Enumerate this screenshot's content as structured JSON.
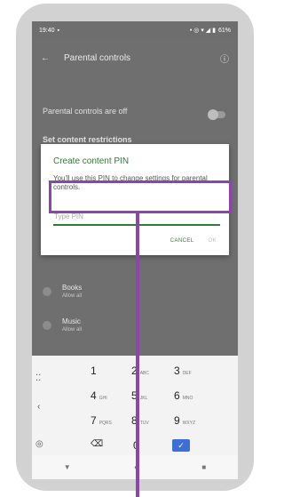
{
  "status_bar": {
    "time": "19:40",
    "left_icon": "notification-icon",
    "right_icons": "• ◎ ▾ ◢ ▮",
    "battery": "61%"
  },
  "app_bar": {
    "back_icon": "←",
    "title": "Parental controls",
    "info_icon": "ⓘ"
  },
  "settings": {
    "status_text": "Parental controls are off",
    "section_title": "Set content restrictions",
    "items": [
      {
        "title": "Books",
        "subtitle": "Allow all"
      },
      {
        "title": "Music",
        "subtitle": "Allow all"
      }
    ]
  },
  "dialog": {
    "title": "Create content PIN",
    "body": "You'll use this PIN to change settings for parental controls.",
    "pin_placeholder": "Type PIN",
    "cancel_label": "CANCEL",
    "ok_label": "OK"
  },
  "keyboard": {
    "rows": [
      [
        {
          "digit": "1",
          "sub": ""
        },
        {
          "digit": "2",
          "sub": "ABC"
        },
        {
          "digit": "3",
          "sub": "DEF"
        }
      ],
      [
        {
          "digit": "4",
          "sub": "GHI"
        },
        {
          "digit": "5",
          "sub": "JKL"
        },
        {
          "digit": "6",
          "sub": "MNO"
        }
      ],
      [
        {
          "digit": "7",
          "sub": "PQRS"
        },
        {
          "digit": "8",
          "sub": "TUV"
        },
        {
          "digit": "9",
          "sub": "WXYZ"
        }
      ]
    ],
    "backspace": "⌫",
    "zero": "0",
    "done": "✓",
    "side_left": "⁚⁚",
    "side_left_2": "‹",
    "side_left_3": "◎"
  },
  "nav_bar": {
    "back": "▼",
    "home": "●",
    "recents": "■"
  },
  "colors": {
    "accent": "#2e7d32",
    "highlight": "#8e44ad",
    "scrim": "#6f6f6f",
    "done_key": "#3d6fd6"
  }
}
